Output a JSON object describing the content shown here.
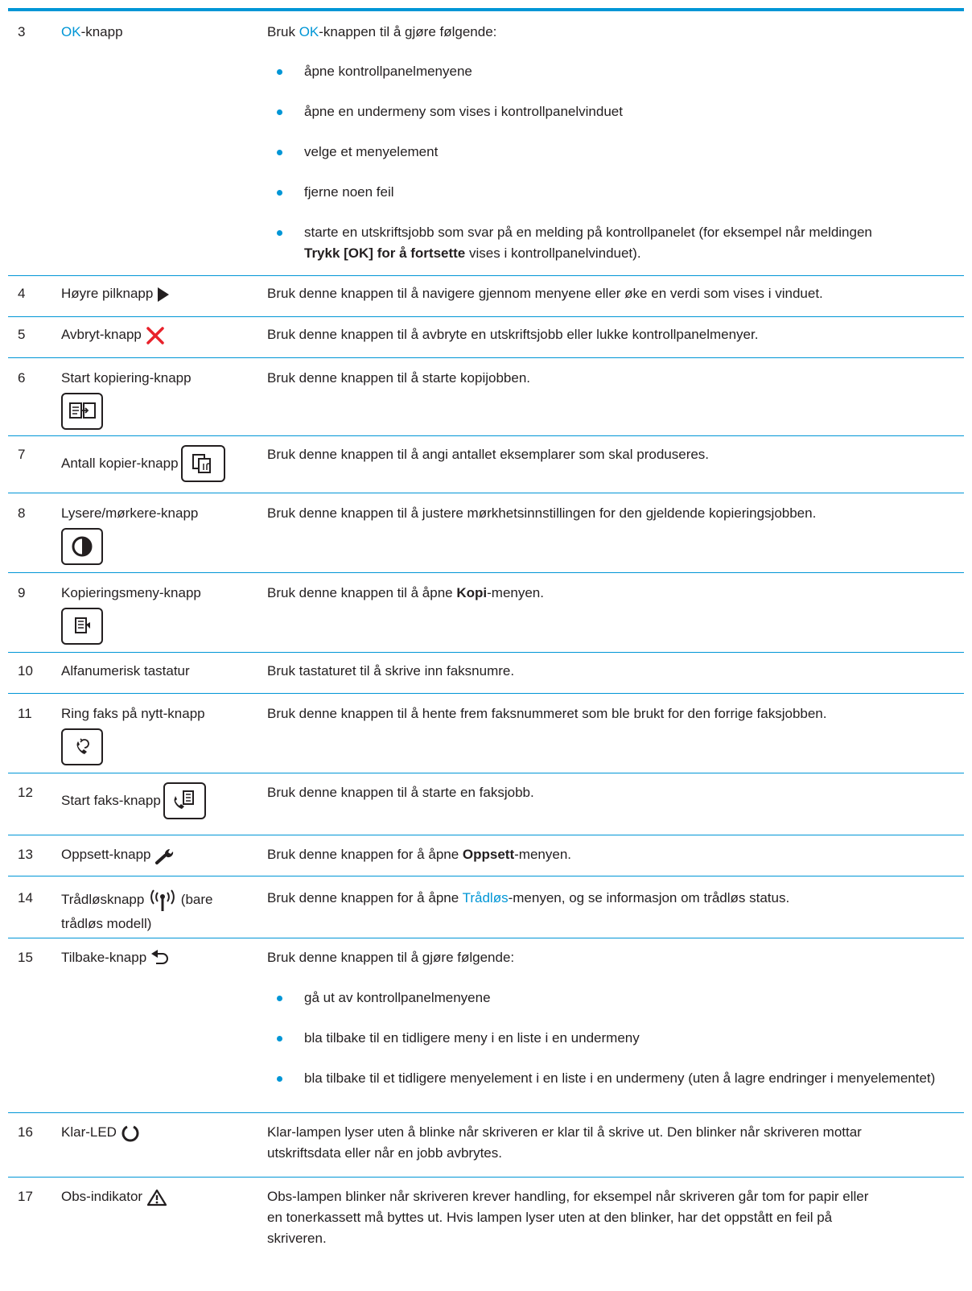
{
  "colors": {
    "accent": "#0096d6",
    "text": "#231f20",
    "cancel": "#e8222b"
  },
  "rows": [
    {
      "num": "3",
      "item_hl": "OK",
      "item_rest": "-knapp",
      "desc_pre": "Bruk ",
      "desc_hl": "OK",
      "desc_post": "-knappen til å gjøre følgende:",
      "bullets": [
        "åpne kontrollpanelmenyene",
        "åpne en undermeny som vises i kontrollpanelvinduet",
        "velge et menyelement",
        "fjerne noen feil"
      ],
      "bullet5_pre": "starte en utskriftsjobb som svar på en melding på kontrollpanelet (for eksempel når meldingen",
      "bullet5_bold": "Trykk [OK] for å fortsette",
      "bullet5_post": " vises i kontrollpanelvinduet)."
    },
    {
      "num": "4",
      "item": "Høyre pilknapp",
      "icon": "right-arrow-icon",
      "desc": "Bruk denne knappen til å navigere gjennom menyene eller øke en verdi som vises i vinduet."
    },
    {
      "num": "5",
      "item": "Avbryt-knapp",
      "icon": "cancel-x-icon",
      "desc": "Bruk denne knappen til å avbryte en utskriftsjobb eller lukke kontrollpanelmenyer."
    },
    {
      "num": "6",
      "item": "Start kopiering-knapp",
      "icon": "start-copy-icon",
      "desc": "Bruk denne knappen til å starte kopijobben."
    },
    {
      "num": "7",
      "item": "Antall kopier-knapp",
      "icon": "number-of-copies-icon",
      "desc": "Bruk denne knappen til å angi antallet eksemplarer som skal produseres."
    },
    {
      "num": "8",
      "item": "Lysere/mørkere-knapp",
      "icon": "lighter-darker-icon",
      "desc": "Bruk denne knappen til å justere mørkhetsinnstillingen for den gjeldende kopieringsjobben."
    },
    {
      "num": "9",
      "item": "Kopieringsmeny-knapp",
      "icon": "copy-menu-icon",
      "desc_pre": "Bruk denne knappen til å åpne ",
      "desc_bold": "Kopi",
      "desc_post": "-menyen."
    },
    {
      "num": "10",
      "item": "Alfanumerisk tastatur",
      "desc": "Bruk tastaturet til å skrive inn faksnumre."
    },
    {
      "num": "11",
      "item": "Ring faks på nytt-knapp",
      "icon": "redial-fax-icon",
      "desc": "Bruk denne knappen til å hente frem faksnummeret som ble brukt for den forrige faksjobben."
    },
    {
      "num": "12",
      "item": "Start faks-knapp",
      "icon": "start-fax-icon",
      "desc": "Bruk denne knappen til å starte en faksjobb."
    },
    {
      "num": "13",
      "item": "Oppsett-knapp",
      "icon": "wrench-icon",
      "desc_pre": "Bruk denne knappen for å åpne ",
      "desc_bold": "Oppsett",
      "desc_post": "-menyen."
    },
    {
      "num": "14",
      "item_pre": "Trådløsknapp",
      "item_post": "(bare",
      "item_line2": "trådløs modell)",
      "icon": "wireless-icon",
      "desc_pre": "Bruk denne knappen for å åpne ",
      "desc_hl": "Trådløs",
      "desc_post": "-menyen, og se informasjon om trådløs status."
    },
    {
      "num": "15",
      "item": "Tilbake-knapp",
      "icon": "back-arrow-icon",
      "desc": "Bruk denne knappen til å gjøre følgende:",
      "bullets": [
        "gå ut av kontrollpanelmenyene",
        "bla tilbake til en tidligere meny i en liste i en undermeny",
        "bla tilbake til et tidligere menyelement i en liste i en undermeny (uten å lagre endringer i menyelementet)"
      ]
    },
    {
      "num": "16",
      "item": "Klar-LED",
      "icon": "ready-led-icon",
      "desc_l1": "Klar-lampen lyser uten å blinke når skriveren er klar til å skrive ut. Den blinker når skriveren mottar",
      "desc_l2": "utskriftsdata eller når en jobb avbrytes."
    },
    {
      "num": "17",
      "item": "Obs-indikator",
      "icon": "attention-warning-icon",
      "desc_l1": "Obs-lampen blinker når skriveren krever handling, for eksempel når skriveren går tom for papir eller",
      "desc_l2": "en tonerkassett må byttes ut. Hvis lampen lyser uten at den blinker, har det oppstått en feil på",
      "desc_l3": "skriveren."
    }
  ]
}
